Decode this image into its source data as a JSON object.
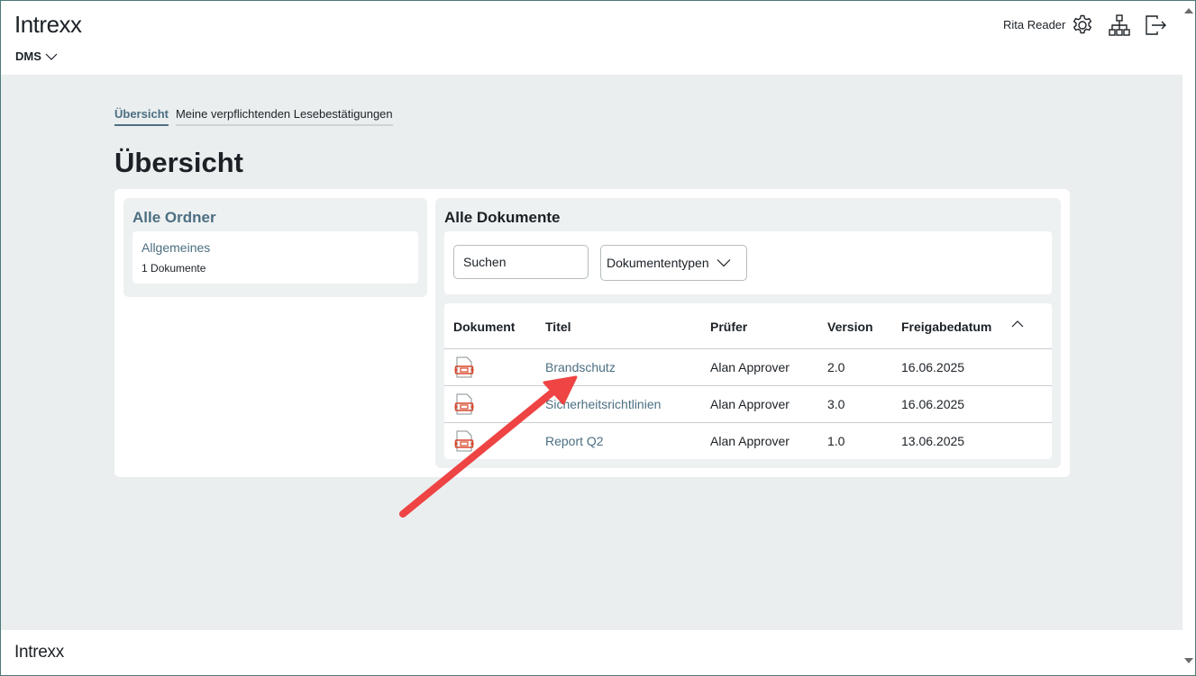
{
  "header": {
    "logo": "Intrexx",
    "app_name": "DMS",
    "user_name": "Rita Reader",
    "icons": [
      "gear-icon",
      "sitemap-icon",
      "logout-icon"
    ]
  },
  "tabs": [
    {
      "label": "Übersicht",
      "active": true
    },
    {
      "label": "Meine verpflichtenden Lesebestätigungen",
      "active": false
    }
  ],
  "page_title": "Übersicht",
  "folders_panel": {
    "title": "Alle Ordner",
    "folders": [
      {
        "name": "Allgemeines",
        "count": "1",
        "count_label": "Dokumente"
      }
    ]
  },
  "documents_panel": {
    "title": "Alle Dokumente",
    "search_placeholder": "Suchen",
    "type_filter": "Dokumententypen",
    "columns": [
      "Dokument",
      "Titel",
      "Prüfer",
      "Version",
      "Freigabedatum"
    ],
    "rows": [
      {
        "icon": "pdf-file-icon",
        "title": "Brandschutz",
        "reviewer": "Alan Approver",
        "version": "2.0",
        "date": "16.06.2025"
      },
      {
        "icon": "pdf-file-icon",
        "title": "Sicherheitsrichtlinien",
        "reviewer": "Alan Approver",
        "version": "3.0",
        "date": "16.06.2025"
      },
      {
        "icon": "pdf-file-icon",
        "title": "Report Q2",
        "reviewer": "Alan Approver",
        "version": "1.0",
        "date": "13.06.2025"
      }
    ]
  },
  "footer": {
    "logo": "Intrexx"
  },
  "colors": {
    "accent": "#4c6f82",
    "background": "#eaeeef",
    "annotation_arrow": "#ee4444",
    "file_icon": "#d9472b"
  }
}
